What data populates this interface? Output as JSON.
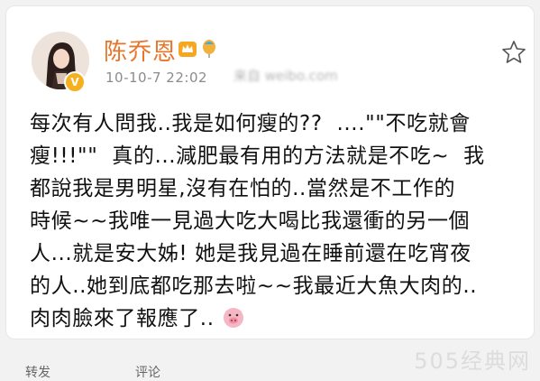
{
  "post": {
    "author": "陈乔恩",
    "timestamp": "10-10-7 22:02",
    "source": "来自 weibo.com",
    "text": "每次有人問我..我是是如何瘦的??  ....\"\"不吃就會瘦!!!\"\"  真的...減肥最有用的方法就是不吃~  我都說我是男明星,沒有在怕的..當然是不工作的時候~~我唯一見過大吃大喝比我還衝的另一個人...就是安大姊! 她是我見過在睡前還在吃宵夜的人..她到底都吃那去啦~~我最近大魚大肉的..肉肉臉來了報應了..",
    "lines": [
      "每次有人問我..我是如何瘦的??  ....\"\"不吃就會",
      "瘦!!!\"\"  真的...減肥最有用的方法就是不吃~  我",
      "都說我是男明星,沒有在怕的..當然是不工作的",
      "時候~~我唯一見過大吃大喝比我還衝的另一個",
      "人...就是安大姊! 她是我見過在睡前還在吃宵夜",
      "的人..她到底都吃那去啦~~我最近大魚大肉的..",
      "肉肉臉來了報應了.."
    ]
  },
  "icons": {
    "verified": "verified-badge-icon",
    "member": "vip-crown-icon",
    "balloon": "balloon-icon",
    "favorite": "star-icon",
    "emoji": "pig-face-emoji"
  },
  "watermark": "505经典网",
  "actions": {
    "repost": "转发",
    "comment": "评论"
  },
  "colors": {
    "author": "#e7762c",
    "text": "#111111",
    "meta": "#8c8c8c"
  }
}
